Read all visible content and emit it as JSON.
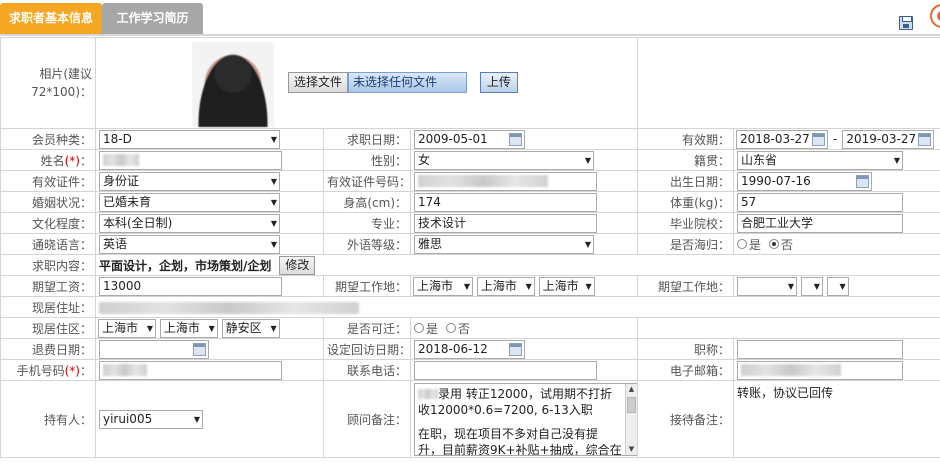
{
  "tabs": [
    {
      "label": "求职者基本信息"
    },
    {
      "label": "工作学习简历"
    }
  ],
  "photo": {
    "label_line1": "相片(建议",
    "label_line2": "72*100)：",
    "choose_file": "选择文件",
    "no_file": "未选择任何文件",
    "upload": "上传"
  },
  "row_member": {
    "member_label": "会员种类：",
    "member_value": "18-D",
    "apply_date_label": "求职日期：",
    "apply_date": "2009-05-01",
    "valid_label": "有效期：",
    "valid_from": "2018-03-27",
    "valid_sep": "-",
    "valid_to": "2019-03-27"
  },
  "row_name": {
    "name_label": "姓名",
    "req": "(*)",
    "colon": "：",
    "gender_label": "性别：",
    "gender": "女",
    "native_label": "籍贯：",
    "native": "山东省"
  },
  "row_id": {
    "id_type_label": "有效证件：",
    "id_type": "身份证",
    "id_no_label": "有效证件号码：",
    "birth_label": "出生日期：",
    "birth": "1990-07-16"
  },
  "row_marriage": {
    "marriage_label": "婚姻状况：",
    "marriage": "已婚未育",
    "height_label": "身高(cm)：",
    "height": "174",
    "weight_label": "体重(kg)：",
    "weight": "57"
  },
  "row_edu": {
    "edu_label": "文化程度：",
    "edu": "本科(全日制)",
    "major_label": "专业：",
    "major": "技术设计",
    "school_label": "毕业院校：",
    "school": "合肥工业大学"
  },
  "row_lang": {
    "lang_label": "通晓语言：",
    "lang": "英语",
    "level_label": "外语等级：",
    "level": "雅思",
    "overseas_label": "是否海归：",
    "yes": "是",
    "no": "否"
  },
  "row_seek": {
    "seek_label": "求职内容：",
    "seek": "平面设计，企划，市场策划/企划",
    "modify": "修改"
  },
  "row_salary": {
    "salary_label": "期望工资：",
    "salary": "13000",
    "place_label": "期望工作地：",
    "p1": "上海市",
    "p2": "上海市",
    "p3": "上海市",
    "place2_label": "期望工作地："
  },
  "row_addr": {
    "addr_label": "现居住址："
  },
  "row_area": {
    "area_label": "现居住区：",
    "a1": "上海市",
    "a2": "上海市",
    "a3": "静安区",
    "move_label": "是否可迁：",
    "yes": "是",
    "no": "否"
  },
  "row_refund": {
    "refund_label": "退费日期：",
    "visit_label": "设定回访日期：",
    "visit": "2018-06-12",
    "title_label": "职称："
  },
  "row_phone": {
    "phone_label": "手机号码",
    "req": "(*)",
    "colon": "：",
    "contact_label": "联系电话：",
    "email_label": "电子邮箱："
  },
  "row_owner": {
    "owner_label": "持有人：",
    "owner": "yirui005",
    "note_label": "顾问备注：",
    "note_line1": "录用  转正12000，试用期不打折",
    "note_line2": "收12000*0.6=7200, 6-13入职",
    "note_line3": "在职，现在项目不多对自己没有提",
    "note_line4": "升，目前薪资9K+补贴+抽成，综合在",
    "reception_label": "接待备注：",
    "reception": "转账，协议已回传"
  }
}
